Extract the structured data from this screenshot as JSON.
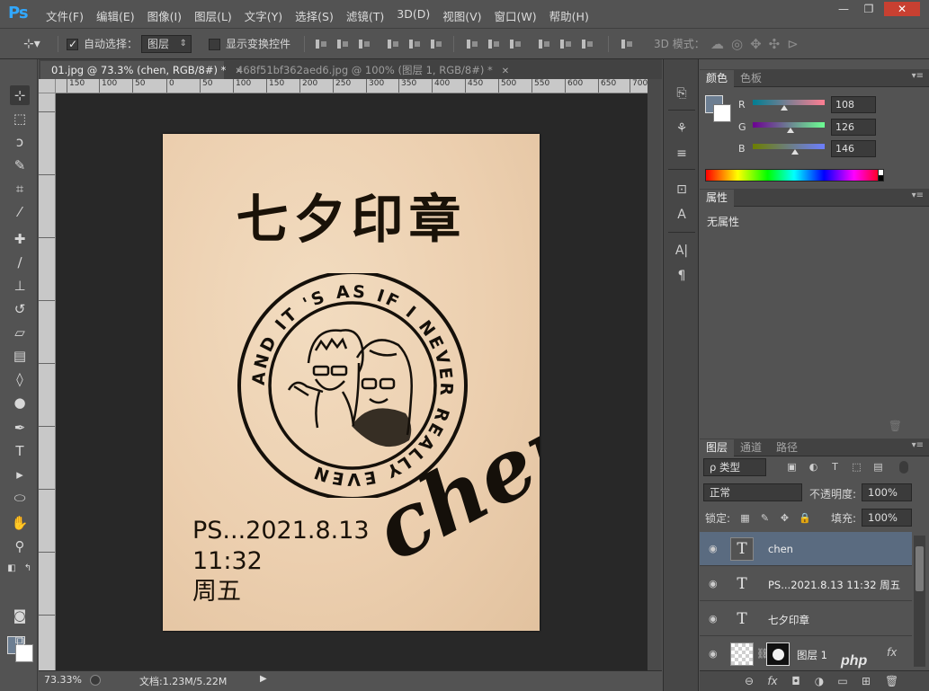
{
  "app": {
    "logo": "Ps",
    "menu": [
      "文件(F)",
      "编辑(E)",
      "图像(I)",
      "图层(L)",
      "文字(Y)",
      "选择(S)",
      "滤镜(T)",
      "3D(D)",
      "视图(V)",
      "窗口(W)",
      "帮助(H)"
    ],
    "window_buttons": {
      "minimize": "—",
      "restore": "❐",
      "close": "✕"
    }
  },
  "options": {
    "auto_select_label": "自动选择：",
    "auto_select_checked": true,
    "auto_select_target": "图层",
    "show_transform_label": "显示变换控件",
    "show_transform_checked": false,
    "mode_3d_label": "3D 模式："
  },
  "tabs": [
    {
      "label": "01.jpg @ 73.3% (chen, RGB/8#) *",
      "active": true
    },
    {
      "label": "468f51bf362aed6.jpg @ 100% (图层 1, RGB/8#) *",
      "active": false
    }
  ],
  "ruler": {
    "ticks": [
      "150",
      "100",
      "50",
      "0",
      "50",
      "100",
      "150",
      "200",
      "250",
      "300",
      "350",
      "400",
      "450",
      "500",
      "550",
      "600",
      "650",
      "700"
    ]
  },
  "canvas": {
    "title": "七夕印章",
    "stamp_text": "AND IT 'S AS IF I NEVER REALLY EVEN",
    "date_lines": [
      "PS...2021.8.13",
      "11:32",
      "周五"
    ],
    "signature": "chen"
  },
  "status": {
    "zoom": "73.33%",
    "doc": "文档:1.23M/5.22M",
    "arrow": "▶"
  },
  "color_panel": {
    "tabs": [
      "颜色",
      "色板"
    ],
    "fg_color": "#6c7e92",
    "bg_color": "#ffffff",
    "r": {
      "label": "R",
      "value": "108"
    },
    "g": {
      "label": "G",
      "value": "126"
    },
    "b": {
      "label": "B",
      "value": "146"
    }
  },
  "properties_panel": {
    "tab": "属性",
    "empty_text": "无属性"
  },
  "layers_panel": {
    "tabs": [
      "图层",
      "通道",
      "路径"
    ],
    "filter_label": "ρ 类型",
    "blend_mode": "正常",
    "opacity_label": "不透明度:",
    "opacity_value": "100%",
    "lock_label": "锁定:",
    "fill_label": "填充:",
    "fill_value": "100%",
    "layers": [
      {
        "name": "chen",
        "type": "text",
        "selected": true
      },
      {
        "name": "PS...2021.8.13  11:32 周五",
        "type": "text",
        "selected": false
      },
      {
        "name": "七夕印章",
        "type": "text",
        "selected": false
      },
      {
        "name": "图层 1",
        "type": "image",
        "selected": false
      }
    ],
    "footer_icons": [
      "link-icon",
      "fx-icon",
      "mask-icon",
      "adjustment-icon",
      "folder-icon",
      "new-layer-icon",
      "trash-icon"
    ]
  },
  "watermark": "php"
}
